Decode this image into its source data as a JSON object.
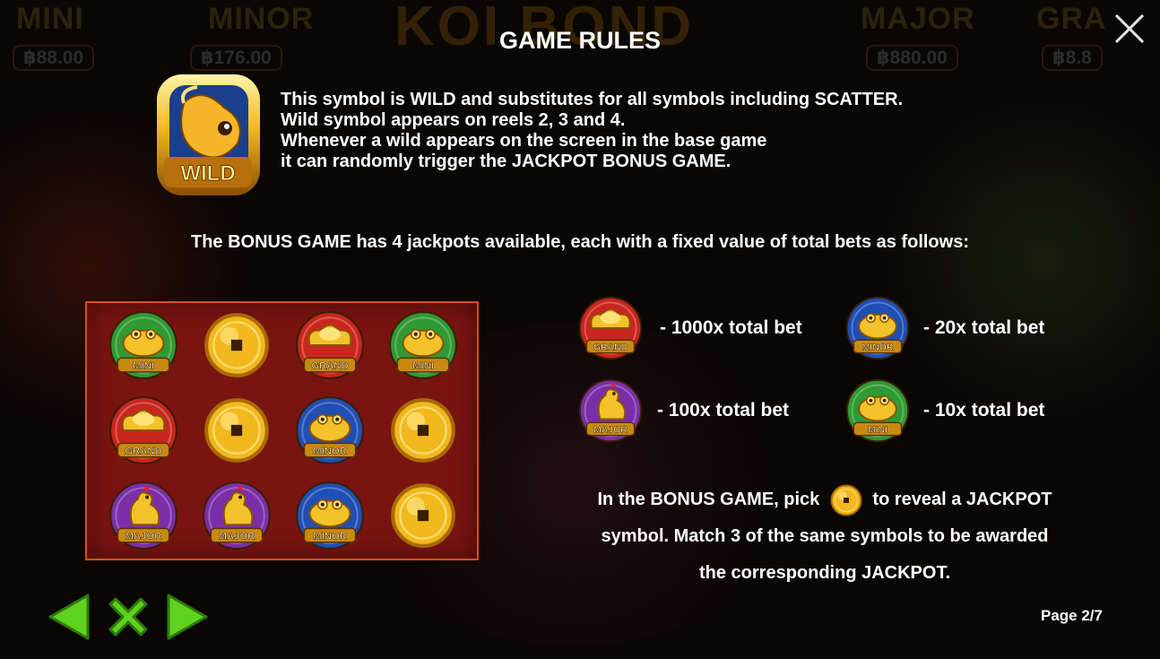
{
  "background": {
    "jackpot_labels": [
      "MINI",
      "MINOR",
      "MAJOR",
      "GRA"
    ],
    "jackpot_values": [
      "฿88.00",
      "฿176.00",
      "฿880.00",
      "฿8.8"
    ],
    "logo_text": "KOI BOND"
  },
  "title": "GAME RULES",
  "wild": {
    "icon": "wild-koi-symbol",
    "badge": "WILD",
    "lines": [
      "This symbol is WILD and substitutes for all symbols including SCATTER.",
      "Wild symbol appears on reels 2, 3 and 4.",
      "Whenever a wild appears on the screen in the base game",
      "it can randomly trigger the JACKPOT BONUS GAME."
    ]
  },
  "bonus_intro": "The BONUS GAME has 4 jackpots available, each with a fixed value of total bets as follows:",
  "grid": {
    "rows": [
      [
        "MINI",
        "coin",
        "GRAND",
        "MINI"
      ],
      [
        "GRAND",
        "coin",
        "MINOR",
        "coin"
      ],
      [
        "MAJOR",
        "MAJOR",
        "MINOR",
        "coin"
      ]
    ]
  },
  "jackpots": [
    {
      "name": "GRAND",
      "text": "- 1000x total bet",
      "color": "#c8261e"
    },
    {
      "name": "MINOR",
      "text": "- 20x total bet",
      "color": "#1f4fb4"
    },
    {
      "name": "MAJOR",
      "text": "- 100x total bet",
      "color": "#7a2fa8"
    },
    {
      "name": "MINI",
      "text": "- 10x total bet",
      "color": "#2f9a34"
    }
  ],
  "bonus_desc": {
    "line1_before": "In the BONUS GAME, pick",
    "line1_after": "to reveal a JACKPOT",
    "line2": "symbol. Match 3 of the same symbols to be awarded",
    "line3": "the corresponding JACKPOT."
  },
  "nav": {
    "prev_icon": "arrow-left-icon",
    "close_icon": "x-icon",
    "next_icon": "arrow-right-icon",
    "color": "#5fd11f"
  },
  "page": "Page 2/7",
  "colors": {
    "panel": "#7a1410",
    "panel_border": "#d4511c",
    "gold": "#f2b81e"
  }
}
